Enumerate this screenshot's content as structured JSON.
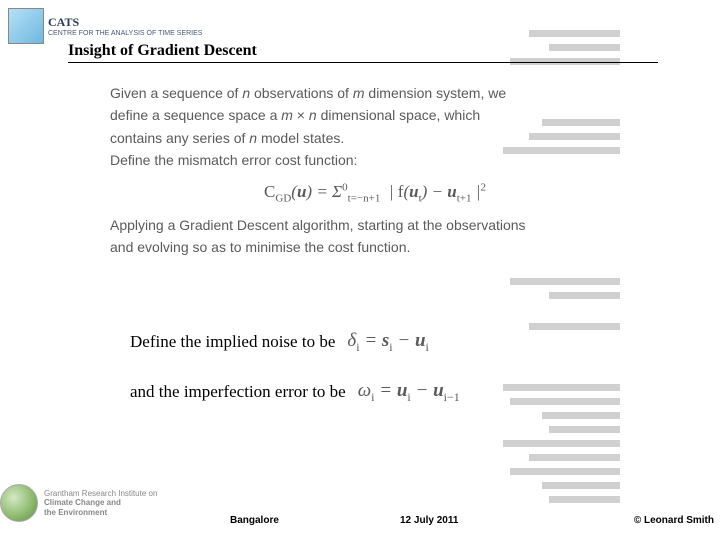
{
  "header": {
    "title": "Insight of Gradient Descent",
    "logo_main": "CATS",
    "logo_sub": "CENTRE FOR THE ANALYSIS OF TIME SERIES"
  },
  "body": {
    "line1": "Given a sequence of n observations of m dimension system, we",
    "line2": "define a sequence space a m × n dimensional space, which",
    "line3": "contains any series of n model states.",
    "line4": "Define the mismatch error cost function:",
    "formula": "C_GD(u) = Σ_{t=-n+1}^{0} | f(u_t) − u_{t+1} |²",
    "line5": "Applying a Gradient Descent algorithm, starting at the observations",
    "line6": "and evolving so as to minimise the cost function."
  },
  "defs": {
    "noise_text": "Define the implied noise to be",
    "noise_formula": "δᵢ = sᵢ − uᵢ",
    "imperf_text": "and the imperfection error to be",
    "imperf_formula": "ωᵢ = uᵢ − uᵢ₋₁"
  },
  "footer": {
    "logo_line1": "Grantham Research Institute on",
    "logo_line2": "Climate Change and",
    "logo_line3": "the Environment",
    "location": "Bangalore",
    "date": "12 July 2011",
    "copyright": "© Leonard Smith"
  }
}
